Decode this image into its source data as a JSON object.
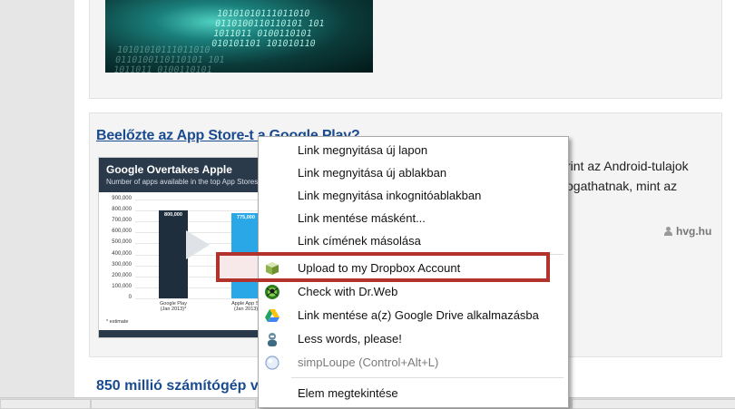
{
  "articles": [
    {
      "title": "Beelőzte az App Store-t a Google Play?",
      "excerpt_lines": [
        "rint az Android-tulajok",
        "ogathatnak, mint az"
      ],
      "source": "hvg.hu"
    },
    {
      "title": "850 millió számítógép v"
    }
  ],
  "image_text": {
    "matrix_code": "10101010111011010\n0110100110110101 101\n1011011 0100110101\n010101101 101010110"
  },
  "infographic": {
    "title": "Google Overtakes Apple",
    "subtitle": "Number of apps available in the top App Stores",
    "y_ticks": [
      "900,000",
      "800,000",
      "700,000",
      "600,000",
      "500,000",
      "400,000",
      "300,000",
      "200,000",
      "100,000",
      "0"
    ],
    "bars": [
      {
        "label": "Google Play\n(Jan 2013)*",
        "value_label": "800,000",
        "value": 800000,
        "color": "#1f2e3d"
      },
      {
        "label": "Apple App St\n(Jan 2013)",
        "value_label": "775,000",
        "value": 775000,
        "color": "#2aa7e6"
      }
    ],
    "ylim": [
      0,
      900000
    ],
    "note": "* estimate"
  },
  "context_menu": {
    "items": [
      {
        "label": "Link megnyitása új lapon",
        "icon": null,
        "disabled": false
      },
      {
        "label": "Link megnyitása új ablakban",
        "icon": null,
        "disabled": false
      },
      {
        "label": "Link megnyitása inkognitóablakban",
        "icon": null,
        "disabled": false
      },
      {
        "label": "Link mentése másként...",
        "icon": null,
        "disabled": false
      },
      {
        "label": "Link címének másolása",
        "icon": null,
        "disabled": false
      },
      {
        "label": "Upload to my Dropbox Account",
        "icon": "dropbox-box-icon",
        "disabled": false,
        "highlighted": true
      },
      {
        "label": "Check with Dr.Web",
        "icon": "drweb-spider-icon",
        "disabled": false
      },
      {
        "label": "Link mentése a(z) Google Drive alkalmazásba",
        "icon": "google-drive-icon",
        "disabled": false
      },
      {
        "label": "Less words, please!",
        "icon": "less-words-icon",
        "disabled": false
      },
      {
        "label": "simpLoupe (Control+Alt+L)",
        "icon": "magnifier-icon",
        "disabled": true
      },
      {
        "label": "Elem megtekintése",
        "icon": null,
        "disabled": false
      }
    ]
  },
  "colors": {
    "link_blue": "#1a4b8f",
    "highlight_border": "#b1332c"
  }
}
